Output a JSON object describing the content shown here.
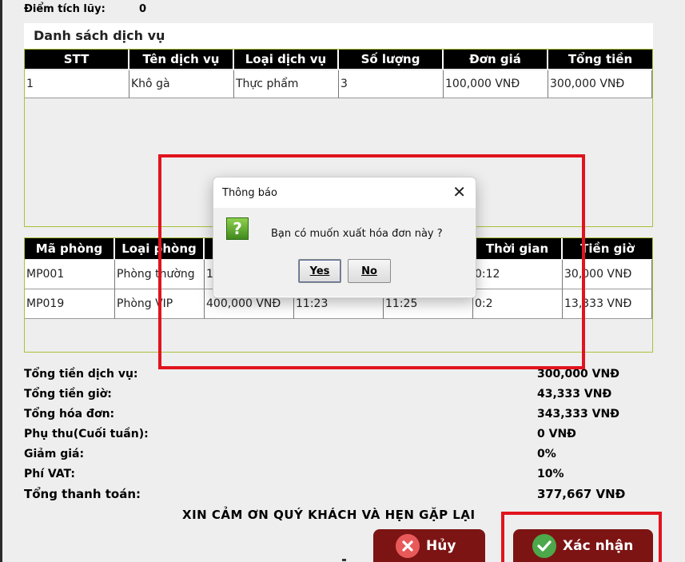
{
  "loyalty": {
    "label": "Điểm tích lũy:",
    "value": "0"
  },
  "services": {
    "title": "Danh sách dịch vụ",
    "columns": [
      "STT",
      "Tên dịch vụ",
      "Loại dịch vụ",
      "Số lượng",
      "Đơn giá",
      "Tổng tiền"
    ],
    "rows": [
      [
        "1",
        "Khô gà",
        "Thực phẩm",
        "3",
        "100,000 VNĐ",
        "300,000 VNĐ"
      ]
    ]
  },
  "rooms": {
    "columns": [
      "Mã phòng",
      "Loại phòng",
      "",
      "",
      "",
      "Thời gian",
      "Tiền giờ"
    ],
    "rows": [
      [
        "MP001",
        "Phòng thường",
        "1",
        "",
        "",
        "0:12",
        "30,000 VNĐ"
      ],
      [
        "MP019",
        "Phòng VIP",
        "400,000 VNĐ",
        "11:23",
        "11:25",
        "0:2",
        "13,333 VNĐ"
      ]
    ]
  },
  "summary": [
    {
      "label": "Tổng tiền dịch vụ:",
      "value": "300,000 VNĐ"
    },
    {
      "label": "Tổng tiền giờ:",
      "value": "43,333 VNĐ"
    },
    {
      "label": "Tổng hóa đơn:",
      "value": "343,333 VNĐ"
    },
    {
      "label": "Phụ thu(Cuối tuần):",
      "value": "0 VNĐ"
    },
    {
      "label": "Giảm giá:",
      "value": "0%"
    },
    {
      "label": "Phí VAT:",
      "value": "10%"
    },
    {
      "label": "Tổng thanh toán:",
      "value": "377,667 VNĐ"
    }
  ],
  "thanks": "XIN CẢM ƠN QUÝ KHÁCH VÀ HẸN GẶP LẠI",
  "buttons": {
    "cancel": "Hủy",
    "confirm": "Xác nhận"
  },
  "dialog": {
    "title": "Thông báo",
    "message": "Bạn có muốn xuất hóa đơn này ?",
    "yes": "Yes",
    "no": "No",
    "icon": "question-icon"
  },
  "colors": {
    "accent_red": "#e0141e",
    "button_bg": "#7d1414",
    "panel_border": "#a9c23a"
  }
}
